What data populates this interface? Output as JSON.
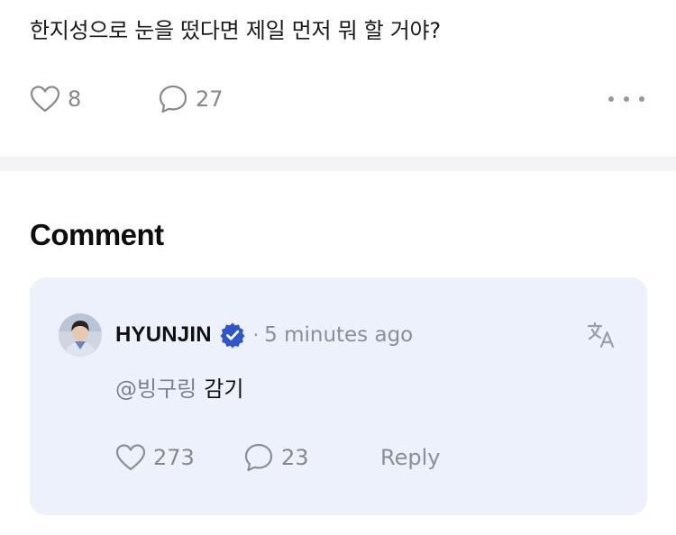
{
  "post": {
    "text": "한지성으로 눈을 떴다면 제일 먼저 뭐 할 거야?",
    "like_count": "8",
    "comment_count": "27",
    "icons": {
      "like": "heart-icon",
      "comment": "speech-bubble-icon",
      "more": "more-dots-icon"
    }
  },
  "comments_section": {
    "title": "Comment",
    "comment": {
      "author": "HYUNJIN",
      "separator": "·",
      "time": "5 minutes ago",
      "mention": "@빙구링",
      "text": "감기",
      "like_count": "273",
      "reply_count": "23",
      "reply_label": "Reply",
      "icons": {
        "verified": "verified-badge-icon",
        "translate": "translate-icon",
        "like": "heart-icon",
        "comment": "speech-bubble-icon"
      }
    }
  },
  "colors": {
    "card_bg": "#ecf1fb",
    "badge": "#2f56c9",
    "muted": "#8a8f99",
    "separator": "#f4f4f6"
  }
}
